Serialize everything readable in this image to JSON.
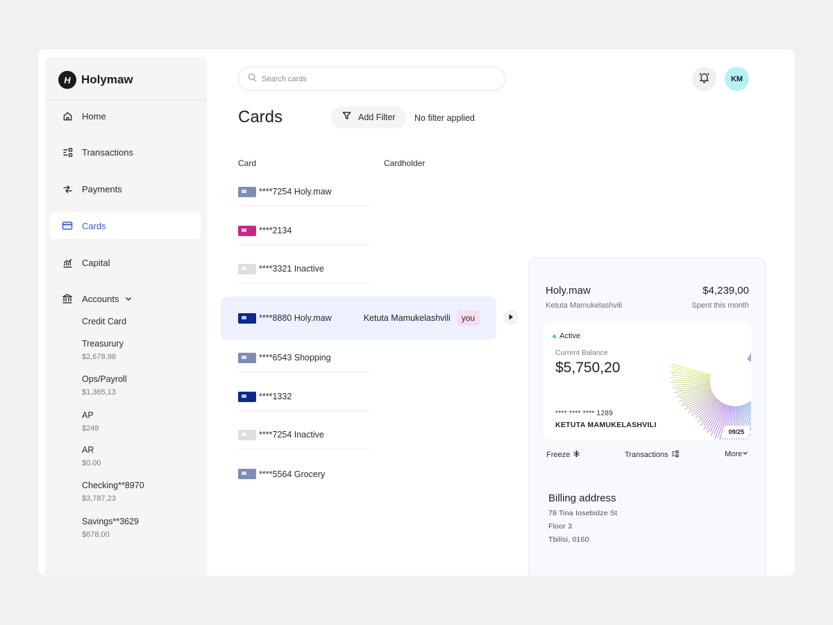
{
  "brand": {
    "name": "Holymaw",
    "logo_letter": "H"
  },
  "nav": {
    "home": "Home",
    "transactions": "Transactions",
    "payments": "Payments",
    "cards": "Cards",
    "capital": "Capital",
    "accounts": "Accounts"
  },
  "accounts": [
    {
      "name": "Credit Card",
      "amount": ""
    },
    {
      "name": "Treasurury",
      "amount": "$2,678,98"
    },
    {
      "name": "Ops/Payroll",
      "amount": "$1,365,13"
    },
    {
      "name": "AP",
      "amount": "$248"
    },
    {
      "name": "AR",
      "amount": "$0.00"
    },
    {
      "name": "Checking**8970",
      "amount": "$3,787,23"
    },
    {
      "name": "Savings**3629",
      "amount": "$678,00"
    }
  ],
  "search": {
    "placeholder": "Search cards",
    "value": ""
  },
  "user": {
    "initials": "KM"
  },
  "page": {
    "title": "Cards",
    "filter_label": "Add Filter",
    "filter_status": "No filter applied",
    "col_card": "Card",
    "col_cardholder": "Cardholder"
  },
  "cards": [
    {
      "label": "****7254 Holy.maw",
      "color": "#7e8db3",
      "cardholder": "",
      "badge": ""
    },
    {
      "label": "****2134",
      "color": "#c42a86",
      "cardholder": "",
      "badge": ""
    },
    {
      "label": "****3321 Inactive",
      "color": "#dedede",
      "cardholder": "",
      "badge": ""
    },
    {
      "label": "****8880 Holy.maw",
      "color": "#0b2a8c",
      "cardholder": "Ketuta Mamukelashvili",
      "badge": "you"
    },
    {
      "label": "****6543 Shopping",
      "color": "#7e8db3",
      "cardholder": "",
      "badge": ""
    },
    {
      "label": "****1332",
      "color": "#0b2a8c",
      "cardholder": "",
      "badge": ""
    },
    {
      "label": "****7254 Inactive",
      "color": "#dedede",
      "cardholder": "",
      "badge": ""
    },
    {
      "label": "****5564 Grocery",
      "color": "#7e8db3",
      "cardholder": "",
      "badge": ""
    }
  ],
  "detail": {
    "name": "Holy.maw",
    "amount": "$4,239,00",
    "holder": "Ketuta Mamukelashvili",
    "amount_caption": "Spent this month",
    "card": {
      "status": "Active",
      "balance_label": "Current Balance",
      "balance": "$5,750,20",
      "masked_number": "**** **** **** 1289",
      "holder_caps": "KETUTA MAMUKELASHVILI",
      "expiry": "09/25"
    },
    "actions": {
      "freeze": "Freeze",
      "transactions": "Transactions",
      "more": "More"
    },
    "billing": {
      "title": "Billing address",
      "line1": "78 Tina Iosebidze St",
      "line2": "Floor 3",
      "line3": "Tbilisi, 0160"
    }
  },
  "colors": {
    "accent": "#3b5bdb",
    "selected_row": "#edf1fd",
    "active_dot": "#3ddc84",
    "you_badge": "#f6dcf0"
  }
}
